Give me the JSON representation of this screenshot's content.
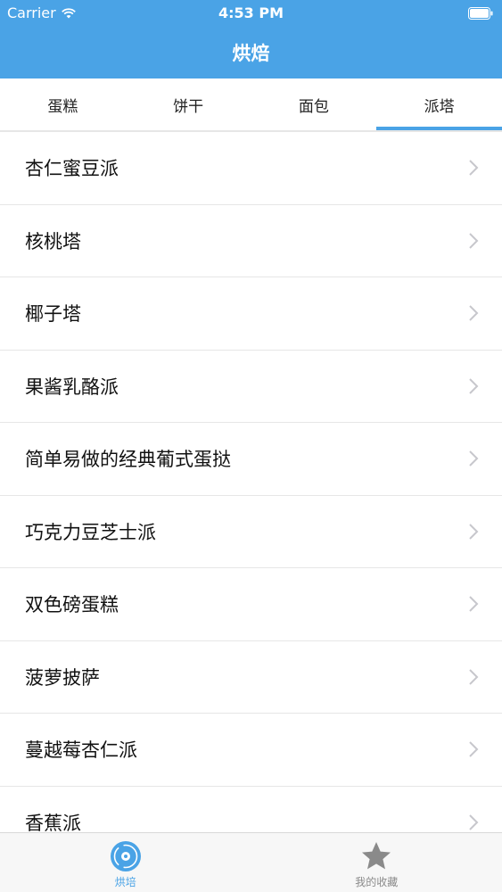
{
  "status_bar": {
    "carrier": "Carrier",
    "time": "4:53 PM"
  },
  "nav": {
    "title": "烘焙"
  },
  "tabs": [
    {
      "label": "蛋糕",
      "active": false
    },
    {
      "label": "饼干",
      "active": false
    },
    {
      "label": "面包",
      "active": false
    },
    {
      "label": "派塔",
      "active": true
    }
  ],
  "list": [
    {
      "label": "杏仁蜜豆派"
    },
    {
      "label": "核桃塔"
    },
    {
      "label": "椰子塔"
    },
    {
      "label": "果酱乳酪派"
    },
    {
      "label": "简单易做的经典葡式蛋挞"
    },
    {
      "label": "巧克力豆芝士派"
    },
    {
      "label": "双色磅蛋糕"
    },
    {
      "label": "菠萝披萨"
    },
    {
      "label": "蔓越莓杏仁派"
    },
    {
      "label": "香蕉派"
    }
  ],
  "tabbar": [
    {
      "label": "烘培",
      "icon": "disc-icon",
      "active": true
    },
    {
      "label": "我的收藏",
      "icon": "star-icon",
      "active": false
    }
  ],
  "colors": {
    "accent": "#4aa3e6",
    "divider": "#e6e6e6",
    "chevron": "#c7c7cc"
  }
}
